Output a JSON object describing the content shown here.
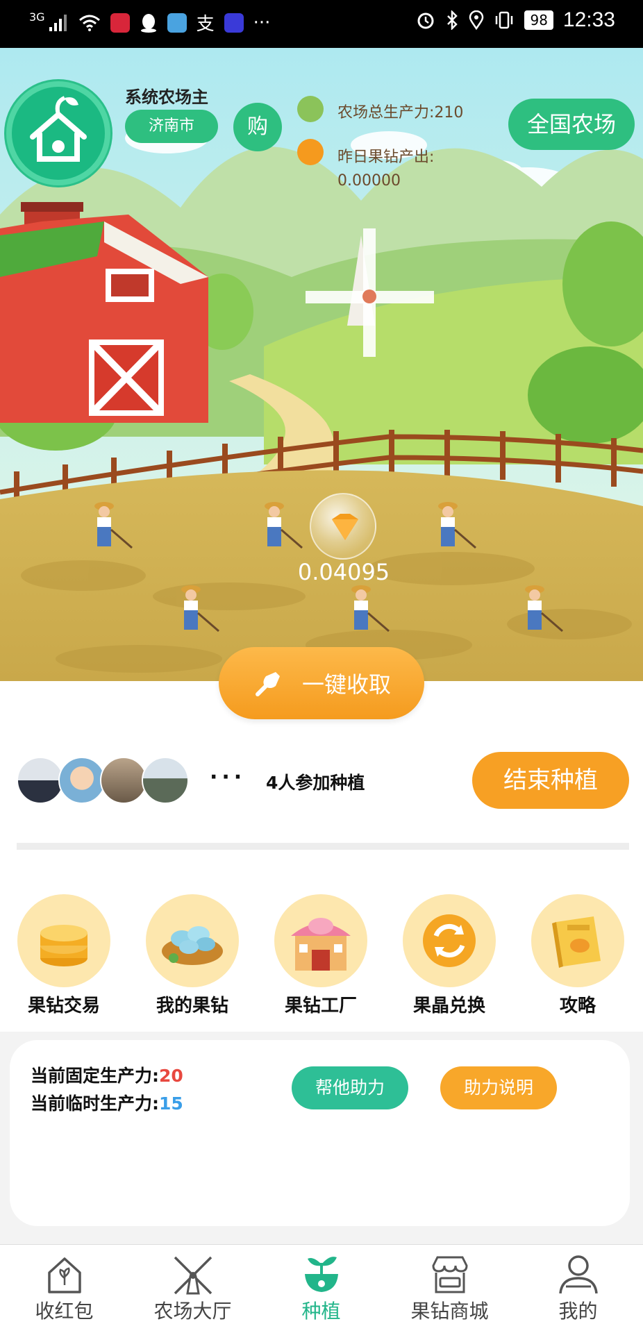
{
  "status_bar": {
    "network": "3G",
    "battery": "98",
    "time": "12:33",
    "extra": "···"
  },
  "header": {
    "owner": "系统农场主",
    "city": "济南市",
    "buy": "购",
    "total_power_label": "农场总生产力:210",
    "yesterday_output_label": "昨日果钻产出:",
    "yesterday_output_value": "0.00000",
    "national_farm": "全国农场"
  },
  "farm": {
    "gem_value": "0.04095",
    "harvest_button": "一键收取"
  },
  "planting": {
    "dots": "···",
    "participants": "4人参加种植",
    "end_button": "结束种植"
  },
  "features": [
    {
      "label": "果钻交易",
      "icon": "coin-stack-icon"
    },
    {
      "label": "我的果钻",
      "icon": "diamond-basket-icon"
    },
    {
      "label": "果钻工厂",
      "icon": "factory-icon"
    },
    {
      "label": "果晶兑换",
      "icon": "exchange-icon"
    },
    {
      "label": "攻略",
      "icon": "album-book-icon"
    }
  ],
  "power": {
    "fixed_label": "当前固定生产力:",
    "fixed_value": "20",
    "temp_label": "当前临时生产力:",
    "temp_value": "15",
    "fixed_color": "#e8483f",
    "temp_color": "#3a9ee8",
    "help_button": "帮他助力",
    "explain_button": "助力说明"
  },
  "nav": [
    {
      "label": "收红包",
      "icon": "house-leaf-icon"
    },
    {
      "label": "农场大厅",
      "icon": "windmill-icon"
    },
    {
      "label": "种植",
      "icon": "sprout-icon",
      "active": true
    },
    {
      "label": "果钻商城",
      "icon": "shop-icon"
    },
    {
      "label": "我的",
      "icon": "user-icon"
    }
  ],
  "colors": {
    "accent_green": "#2ebf80",
    "accent_orange": "#f7a024",
    "active_nav": "#22b58a"
  }
}
